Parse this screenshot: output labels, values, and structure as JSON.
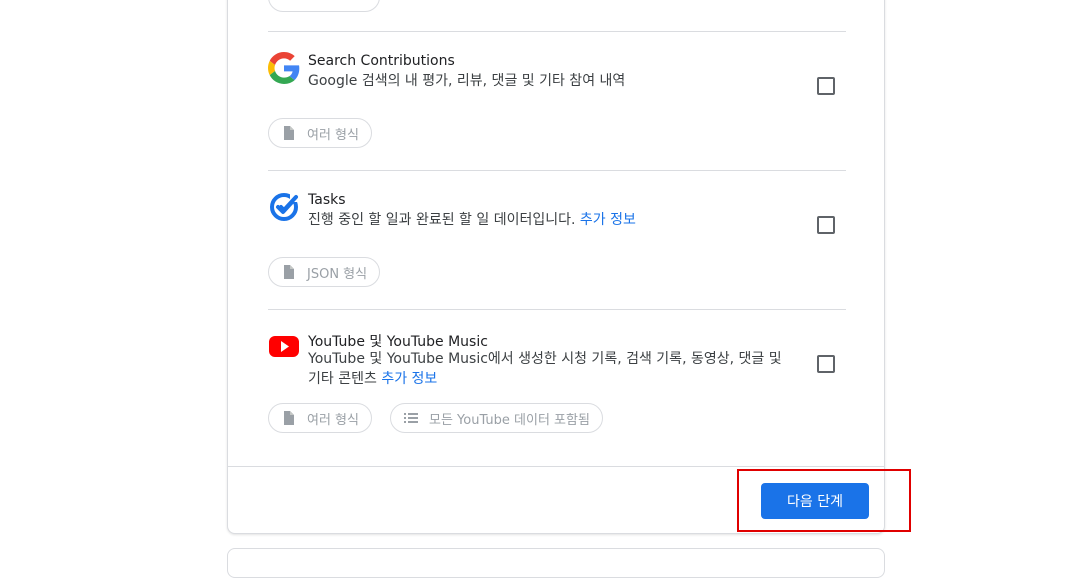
{
  "colors": {
    "accent": "#1a73e8",
    "highlight": "#e00000",
    "divider": "#dadce0"
  },
  "products": [
    {
      "icon": "google-g-icon",
      "title": "Search Contributions",
      "description": "Google 검색의 내 평가, 리뷰, 댓글 및 기타 참여 내역",
      "more_info": "",
      "checked": false,
      "chips": [
        {
          "icon": "file-icon",
          "label": "여러 형식"
        }
      ]
    },
    {
      "icon": "tasks-icon",
      "title": "Tasks",
      "description": "진행 중인 할 일과 완료된 할 일 데이터입니다.",
      "more_info": "추가 정보",
      "checked": false,
      "chips": [
        {
          "icon": "file-icon",
          "label": "JSON 형식"
        }
      ]
    },
    {
      "icon": "youtube-icon",
      "title": "YouTube 및 YouTube Music",
      "description_line1": "YouTube 및 YouTube Music에서 생성한 시청 기록, 검색 기록, 동영상, 댓글 및",
      "description_line2": "기타 콘텐츠",
      "more_info": "추가 정보",
      "checked": false,
      "chips": [
        {
          "icon": "file-icon",
          "label": "여러 형식"
        },
        {
          "icon": "list-icon",
          "label": "모든 YouTube 데이터 포함됨"
        }
      ]
    }
  ],
  "footer": {
    "next_button_label": "다음 단계"
  }
}
